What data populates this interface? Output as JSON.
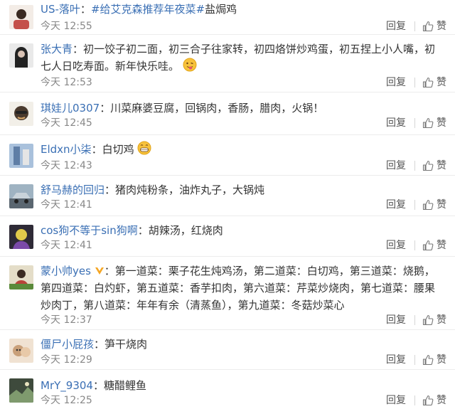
{
  "comments": [
    {
      "user": "US-落叶",
      "sep": "：",
      "hashtag": "#给艾克森推荐年夜菜#",
      "text": "盐焗鸡",
      "time": "今天 12:55",
      "reply": "回复",
      "like": "赞",
      "avatar_color": "#c4504a"
    },
    {
      "user": "张大青",
      "sep": "：",
      "text": "初一饺子初二面，初三合子往家转，初四烙饼炒鸡蛋，初五捏上小人嘴，初七人日吃寿面。新年快乐哇。",
      "emoji": "tongue-face-emoji",
      "time": "今天 12:53",
      "reply": "回复",
      "like": "赞",
      "avatar_color": "#3b3b3b"
    },
    {
      "user": "琪娃儿0307",
      "sep": "：",
      "text": "川菜麻婆豆腐，回锅肉，香肠，腊肉，火锅！",
      "time": "今天 12:45",
      "reply": "回复",
      "like": "赞",
      "avatar_color": "#5a4a3a"
    },
    {
      "user": "Eldxn小柒",
      "sep": "：",
      "text": "白切鸡",
      "emoji": "grin-face-emoji",
      "time": "今天 12:43",
      "reply": "回复",
      "like": "赞",
      "avatar_color": "#7a94b6"
    },
    {
      "user": "舒马赫的回归",
      "sep": "：",
      "text": "猪肉炖粉条，油炸丸子，大锅炖",
      "time": "今天 12:41",
      "reply": "回复",
      "like": "赞",
      "avatar_color": "#6f7b84"
    },
    {
      "user": "cos狗不等于sin狗啊",
      "sep": "：",
      "text": "胡辣汤，红烧肉",
      "time": "今天 12:41",
      "reply": "回复",
      "like": "赞",
      "avatar_color": "#2e2a36"
    },
    {
      "user": "蒙小帅yes",
      "sep": "：",
      "text": "第一道菜：栗子花生炖鸡汤，第二道菜：白切鸡，第三道菜：烧鹅，第四道菜：白灼虾，第五道菜：香芋扣肉，第六道菜：芹菜炒烧肉，第七道菜：腰果炒肉丁，第八道菜：年年有余（清蒸鱼），第九道菜：冬菇炒菜心",
      "vip": "vip-badge-icon",
      "time": "今天 12:37",
      "reply": "回复",
      "like": "赞",
      "avatar_color": "#b8443a"
    },
    {
      "user": "僵尸小屁孩",
      "sep": "：",
      "text": "笋干烧肉",
      "time": "今天 12:29",
      "reply": "回复",
      "like": "赞",
      "avatar_color": "#c9a07a"
    },
    {
      "user": "MrY_9304",
      "sep": "：",
      "text": "糖醋鲤鱼",
      "time": "今天 12:25",
      "reply": "回复",
      "like": "赞",
      "avatar_color": "#4c5a4a"
    }
  ]
}
